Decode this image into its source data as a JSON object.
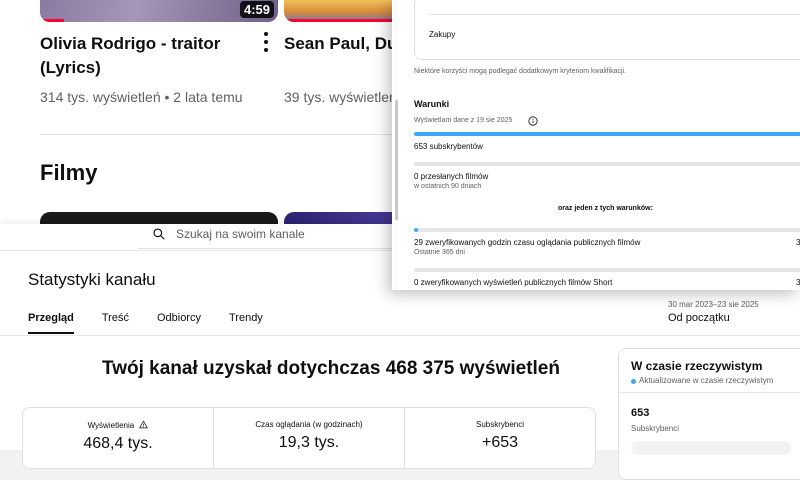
{
  "feed": {
    "videos": [
      {
        "title": "Olivia Rodrigo - traitor (Lyrics)",
        "meta": "314 tys. wyświetleń • 2 lata temu",
        "duration": "4:59",
        "progress": 0.1
      },
      {
        "title": "Sean Paul, Dua (Lyrics)",
        "meta": "39 tys. wyświetleń",
        "progress": 1.0
      }
    ],
    "section_title": "Filmy"
  },
  "studio": {
    "search_placeholder": "Szukaj na swoim kanale",
    "page_title": "Statystyki kanału",
    "tabs": [
      {
        "label": "Przegląd",
        "active": true
      },
      {
        "label": "Treść",
        "active": false
      },
      {
        "label": "Odbiorcy",
        "active": false
      },
      {
        "label": "Trendy",
        "active": false
      }
    ],
    "date_range": "30 mar 2023–23 sie 2025",
    "date_label": "Od początku",
    "headline": "Twój kanał uzyskał dotychczas 468 375 wyświetleń",
    "metrics": [
      {
        "label": "Wyświetlenia",
        "value": "468,4 tys.",
        "warning": true
      },
      {
        "label": "Czas oglądania (w godzinach)",
        "value": "19,3 tys."
      },
      {
        "label": "Subskrybenci",
        "value": "+653"
      }
    ],
    "realtime": {
      "title": "W czasie rzeczywistym",
      "status": "Aktualizowane w czasie rzeczywistym",
      "count": "653",
      "count_label": "Subskrybenci"
    }
  },
  "popup": {
    "purchases_label": "Zakupy",
    "note": "Niektóre korzyści mogą podlegać dodatkowym kryteriom kwalifikacji.",
    "conditions_title": "Warunki",
    "conditions_date": "Wyświetlam dane z 19 sie 2025",
    "requirements": [
      {
        "label": "653 subskrybentów",
        "progress": 1.0
      },
      {
        "label": "0 przesłanych filmów",
        "sub": "w ostatnich 90 dniach",
        "progress": 0.0
      },
      {
        "label": "29 zweryfikowanych godzin czasu oglądania publicznych filmów",
        "sub": "Ostatnie 365 dni",
        "progress": 0.01,
        "right": "3"
      },
      {
        "label": "0 zweryfikowanych wyświetleń publicznych filmów Short",
        "progress": 0.0,
        "right": "3"
      }
    ],
    "or_label": "oraz jeden z tych warunków:"
  },
  "colors": {
    "accent_blue": "#3ea6ff",
    "youtube_red": "#ff0033",
    "text_secondary": "#606060"
  }
}
